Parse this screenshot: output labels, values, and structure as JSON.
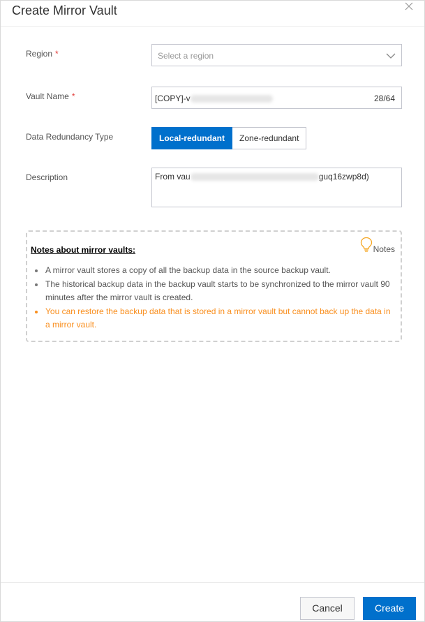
{
  "dialog": {
    "title": "Create Mirror Vault"
  },
  "form": {
    "region": {
      "label": "Region",
      "required_mark": "*",
      "placeholder": "Select a region"
    },
    "vault_name": {
      "label": "Vault Name",
      "required_mark": "*",
      "value_prefix": "[COPY]-v",
      "counter": "28/64"
    },
    "redundancy": {
      "label": "Data Redundancy Type",
      "options": [
        "Local-redundant",
        "Zone-redundant"
      ],
      "selected": "Local-redundant"
    },
    "description": {
      "label": "Description",
      "value_prefix": "From vau",
      "value_suffix": "guq16zwp8d)"
    }
  },
  "notes": {
    "title": "Notes about mirror vaults:",
    "tag": "Notes",
    "items": [
      "A mirror vault stores a copy of all the backup data in the source backup vault.",
      "The historical backup data in the backup vault starts to be synchronized to the mirror vault 90 minutes after the mirror vault is created.",
      "You can restore the backup data that is stored in a mirror vault but cannot back up the data in a mirror vault."
    ],
    "warning_color": "#f98e1d"
  },
  "footer": {
    "cancel_label": "Cancel",
    "create_label": "Create"
  },
  "colors": {
    "primary": "#0070cc",
    "required": "#e23c39"
  },
  "icons": {
    "close": "close-icon",
    "dropdown": "chevron-down-icon",
    "notes": "lightbulb-icon"
  }
}
